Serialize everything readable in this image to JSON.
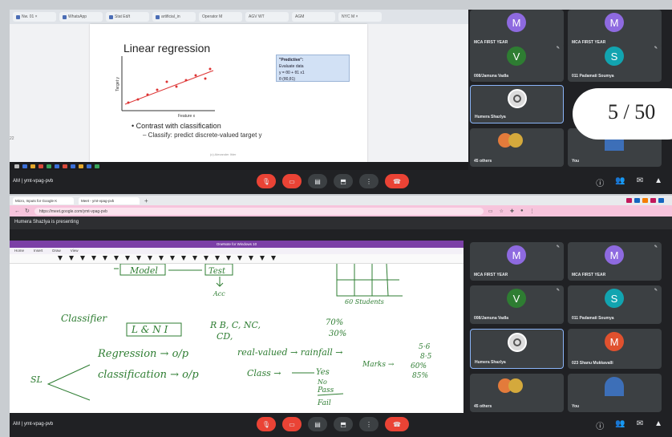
{
  "shot1": {
    "tabs": [
      "Nw. 01 ×",
      "WhatsApp",
      "Stat Ed/t",
      "artificial_in",
      "Operator M",
      "AGV WT",
      "AGM",
      "NYC M ×",
      "tab"
    ],
    "slide": {
      "title": "Linear regression",
      "ylabel": "Target y",
      "xlabel": "Feature x",
      "note_title": "\"Predictive\":",
      "note_line1": "Evaluate data",
      "note_line2": "y = θ0 + θ1 x1",
      "note_line3": "θ (θ0,θ1)",
      "bullet1": "Contrast with classification",
      "bullet2": "Classify: predict discrete-valued target y",
      "footer": "(c) Alexander Ihler"
    },
    "side_label": "22",
    "meeting_code": "AM | ymt-vpag-pvb",
    "page_indicator": "5 / 50",
    "tiles": [
      {
        "initial": "M",
        "name": "MCA FIRST YEAR",
        "color": "#8e6ae0"
      },
      {
        "initial": "M",
        "name": "MCA FIRST YEAR",
        "color": "#8e6ae0"
      },
      {
        "initial": "V",
        "name": "008/Jamuna Vadla",
        "color": "#2e7d32"
      },
      {
        "initial": "S",
        "name": "011 Padamati Soumya",
        "color": "#12a4b0"
      },
      {
        "initial": "",
        "name": "Humera Shazlya",
        "color": "#dcdcdc"
      },
      {
        "initial": "",
        "name": "",
        "color": "#3c4043"
      },
      {
        "initial": "",
        "name": "45 others",
        "color": "#e37b3b"
      },
      {
        "initial": "",
        "name": "You",
        "color": "#3d6fb8"
      }
    ]
  },
  "shot2": {
    "browser_tabs": [
      "Micro, Inputs for Google K",
      "Meet - ymt-vpag-pvb"
    ],
    "url": "https://meet.google.com/ymt-vpag-pvb",
    "presenting": "Humera Shazlya is presenting",
    "onenote_title": "OneNote for Windows 10",
    "onenote_menu": [
      "Home",
      "Insert",
      "Draw",
      "View"
    ],
    "ink": {
      "model": "Model",
      "test": "Test",
      "acc": "Acc",
      "students": "60 Students",
      "classifier": "Classifier",
      "lni": "L & N I",
      "rb": "R B, C, NC,",
      "cd": "CD,",
      "pct1": "70%",
      "pct2": "30%",
      "sl": "SL",
      "regression": "Regression → o/p",
      "realvalued": "real-valued → rainfall →",
      "v1": "5·6",
      "v2": "8·5",
      "classification": "classification → o/p",
      "class": "Class →",
      "yes": "Yes",
      "no": "No",
      "marks": "Marks → ",
      "r60": "60%",
      "r85": "85%",
      "pass": "Pass",
      "fail": "Fail"
    },
    "meeting_code": "AM | ymt-vpag-pvb",
    "tiles": [
      {
        "initial": "M",
        "name": "MCA FIRST YEAR",
        "color": "#8e6ae0"
      },
      {
        "initial": "M",
        "name": "MCA FIRST YEAR",
        "color": "#8e6ae0"
      },
      {
        "initial": "V",
        "name": "008/Jamuna Vadla",
        "color": "#2e7d32"
      },
      {
        "initial": "S",
        "name": "011 Padamati Soumya",
        "color": "#12a4b0"
      },
      {
        "initial": "",
        "name": "Humera Shazlya",
        "color": "#dcdcdc"
      },
      {
        "initial": "M",
        "name": "023 Shanu Mukkavalli",
        "color": "#e0512e"
      },
      {
        "initial": "",
        "name": "45 others",
        "color": "#e37b3b"
      },
      {
        "initial": "",
        "name": "You",
        "color": "#3d6fb8"
      }
    ]
  }
}
